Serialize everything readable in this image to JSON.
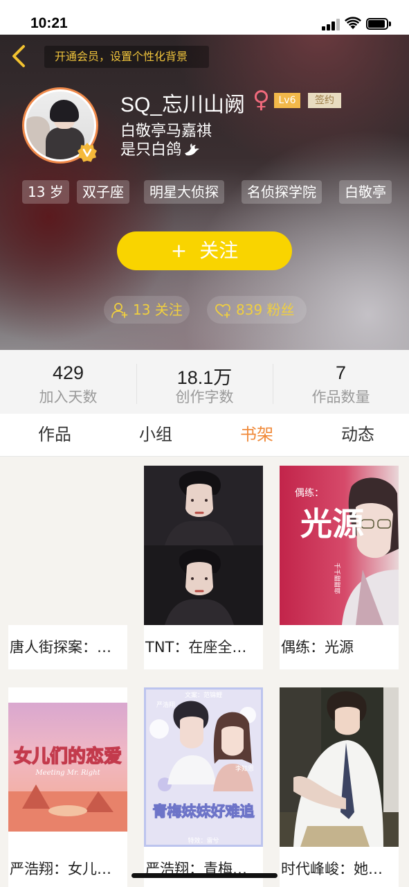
{
  "status": {
    "time": "10:21"
  },
  "header": {
    "vip_banner": "开通会员，设置个性化背景",
    "username": "SQ_忘川山阙",
    "gender_symbol": "♀",
    "level": "Lv6",
    "signed": "签约",
    "bio_line1": "白敬亭马嘉祺",
    "bio_line2": "是只白鸽",
    "tags": [
      "13 岁",
      "双子座",
      "明星大侦探",
      "名侦探学院",
      "白敬亭"
    ],
    "follow_button": "关注",
    "follow_plus": "+",
    "following": "13 关注",
    "fans": "839 粉丝",
    "accent": "#f9d400"
  },
  "stats": [
    {
      "value": "429",
      "label": "加入天数"
    },
    {
      "value": "18.1万",
      "label": "创作字数"
    },
    {
      "value": "7",
      "label": "作品数量"
    }
  ],
  "tabs": [
    {
      "label": "作品",
      "active": false
    },
    {
      "label": "小组",
      "active": false
    },
    {
      "label": "书架",
      "active": true
    },
    {
      "label": "动态",
      "active": false
    }
  ],
  "books": [
    {
      "title": "唐人街探案：…",
      "cover_text": ""
    },
    {
      "title": "TNT：在座全…",
      "cover_text": ""
    },
    {
      "title": "偶练：光源",
      "cover_text": "光源",
      "cover_small": "偶练：",
      "cover_side": "千千甜甜耶"
    },
    {
      "title": "严浩翔：女儿…",
      "cover_text": "女儿们的恋爱",
      "cover_sub": "Meeting Mr. Right"
    },
    {
      "title": "严浩翔：青梅…",
      "cover_text": "青梅妹妹好难追",
      "cover_top": "文案：范锦鲤",
      "cover_name1": "严浩翔",
      "cover_name2": "李知恩",
      "cover_bottom": "特效：雷兮"
    },
    {
      "title": "时代峰峻：她…",
      "cover_text": ""
    }
  ]
}
